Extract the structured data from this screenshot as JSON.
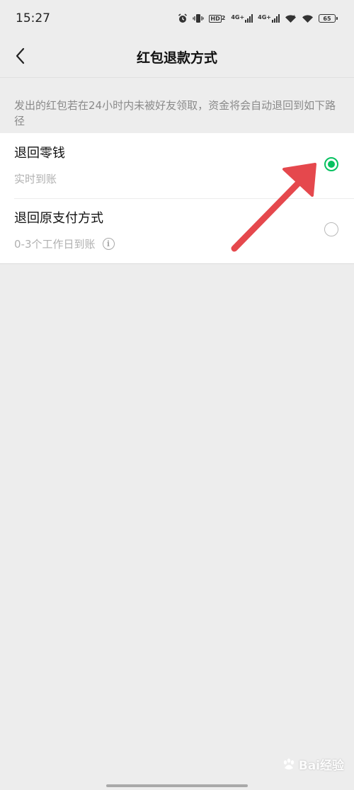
{
  "status_bar": {
    "time": "15:27",
    "hd_label": "HD",
    "hd_sub": "2",
    "signal_1_label": "4G+",
    "signal_2_label": "4G+",
    "battery": "65",
    "icons": [
      "alarm-icon",
      "vibrate-icon",
      "hd-icon",
      "signal-icon",
      "signal-icon",
      "wifi-icon",
      "wifi-icon",
      "battery-icon"
    ]
  },
  "nav": {
    "title": "红包退款方式",
    "back_icon": "chevron-left-icon"
  },
  "hint": "发出的红包若在24小时内未被好友领取，资金将会自动退回到如下路径",
  "options": [
    {
      "title": "退回零钱",
      "subtitle": "实时到账",
      "selected": true
    },
    {
      "title": "退回原支付方式",
      "subtitle": "0-3个工作日到账",
      "selected": false,
      "info_icon": "info-icon"
    }
  ],
  "colors": {
    "accent": "#07c160",
    "background": "#ededed",
    "annotation": "#e5484d"
  },
  "watermark": {
    "text": "Bai经验"
  }
}
